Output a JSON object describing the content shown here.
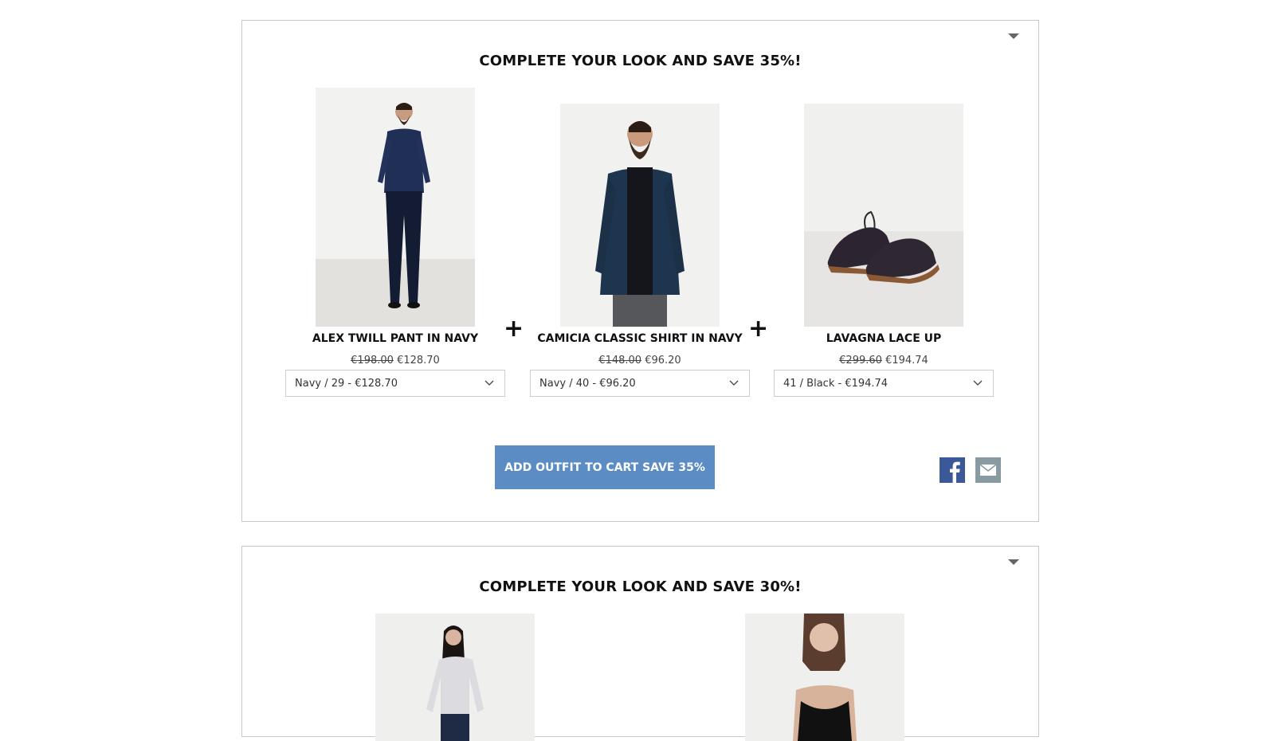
{
  "bundles": [
    {
      "title": "COMPLETE YOUR LOOK AND SAVE 35%!",
      "products": [
        {
          "name": "ALEX TWILL PANT IN NAVY",
          "old_price": "€198.00",
          "new_price": "€128.70",
          "variant": "Navy / 29 - €128.70"
        },
        {
          "name": "CAMICIA CLASSIC SHIRT IN NAVY",
          "old_price": "€148.00",
          "new_price": "€96.20",
          "variant": "Navy / 40 - €96.20"
        },
        {
          "name": "LAVAGNA LACE UP",
          "old_price": "€299.60",
          "new_price": "€194.74",
          "variant": "41 / Black - €194.74"
        }
      ],
      "plus_symbol": "+",
      "cta_label": "ADD OUTFIT TO CART SAVE 35%",
      "share_icons": [
        "facebook-icon",
        "mail-icon"
      ]
    },
    {
      "title": "COMPLETE YOUR LOOK AND SAVE 30%!"
    }
  ],
  "colors": {
    "accent_button": "#5b8cc4",
    "facebook": "#3b5998",
    "mail": "#8a9aa3",
    "border": "#c8c8c8"
  }
}
